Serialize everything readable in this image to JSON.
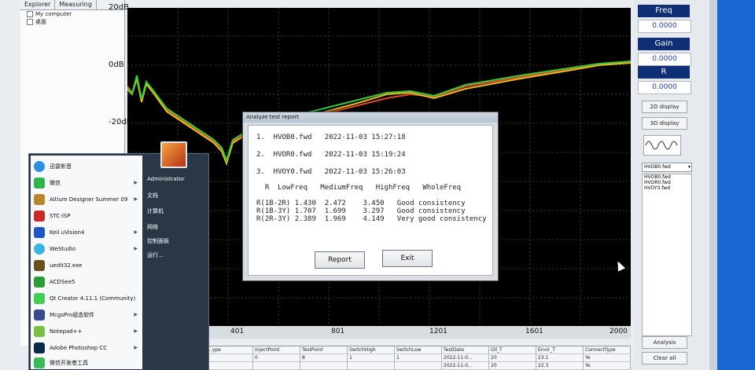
{
  "explorer": {
    "tabs": [
      "Explorer",
      "Measuring"
    ],
    "tree": [
      "My computer",
      "桌面"
    ]
  },
  "plot": {
    "y_labels": [
      "20dB",
      "0dB",
      "-20dB"
    ],
    "x_ticks": [
      "401",
      "801",
      "1201",
      "1601",
      "2000"
    ]
  },
  "table": {
    "headers": [
      "...ype",
      "InjectPoint",
      "TestPoint",
      "SwitchHigh",
      "SwitchLow",
      "TestDate",
      "Oil_T",
      "Envir_T",
      "ConnectType"
    ],
    "rows": [
      [
        "",
        "0",
        "8",
        "1",
        "1",
        "2022-11-0...",
        "20",
        "23.1",
        "Ye"
      ],
      [
        "",
        "",
        "",
        "",
        "",
        "2022-11-0...",
        "20",
        "22.3",
        "Ye"
      ]
    ]
  },
  "right_panel": {
    "freq_title": "Freq",
    "freq_value": "0.0000",
    "gain_title": "Gain",
    "gain_value": "0.0000",
    "r_title": "R",
    "r_value": "0.0000",
    "btn_2d": "2D display",
    "btn_3d": "3D display",
    "select_value": "HVOB0.fwd",
    "files": [
      "HVOB0.fwd",
      "HVOR0.fwd",
      "HVOY0.fwd"
    ],
    "btn_analysis": "Analysis",
    "btn_clear": "Clear all"
  },
  "start_menu": {
    "left_items": [
      "迅雷影音",
      "微信",
      "Altium Designer Summer 09",
      "STC-ISP",
      "Keil uVision4",
      "WeStudio",
      "uedit32.exe",
      "ACDSee5",
      "Qt Creator 4.11.1 (Community)",
      "McgsPro组态软件",
      "Notepad++",
      "Adobe Photoshop CC",
      "微信开发者工具"
    ],
    "right_items": [
      "Administrator",
      "文档",
      "计算机",
      "网络",
      "控制面板",
      "运行..."
    ]
  },
  "dialog": {
    "title": "Analyze test report",
    "lines": [
      "1.  HVOB0.fwd   2022-11-03 15:27:18",
      "2.  HVOR0.fwd   2022-11-03 15:19:24",
      "3.  HVOY0.fwd   2022-11-03 15:26:03",
      "  R  LowFreq   MediumFreq   HighFreq   WholeFreq",
      "R(1B-2R) 1.430  2.472    3.450   Good consistency",
      "R(1B-3Y) 1.707  1.699    3.297   Good consistency",
      "R(2R-3Y) 2.389  1.969    4.149   Very good consistency"
    ],
    "report_label": "Report",
    "exit_label": "Exit"
  }
}
